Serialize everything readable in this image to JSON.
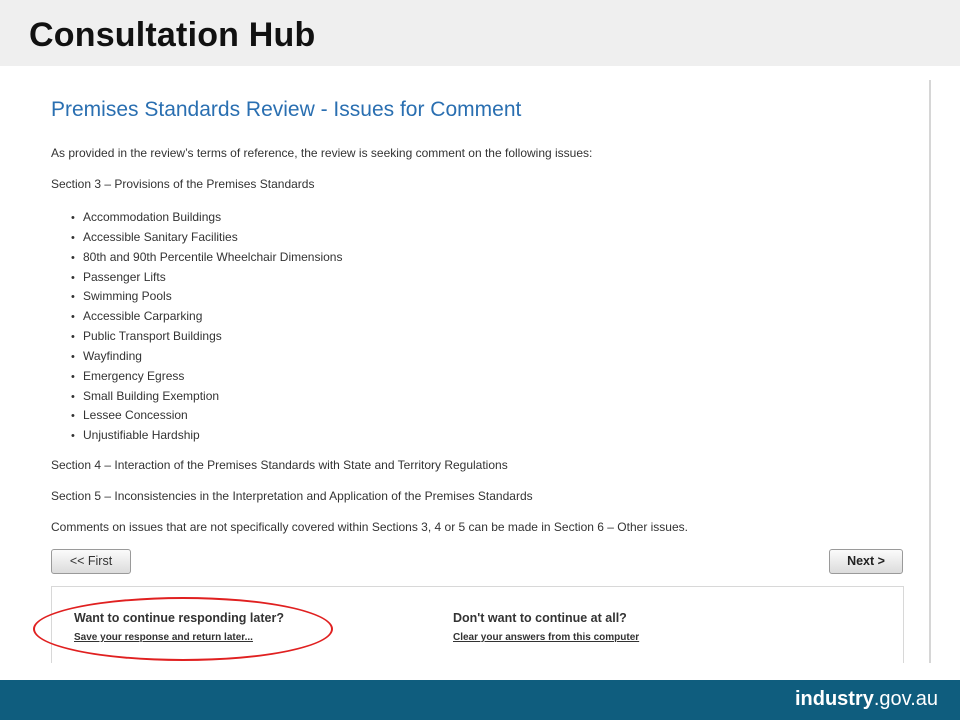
{
  "header": {
    "title": "Consultation Hub"
  },
  "page": {
    "heading": "Premises Standards Review - Issues for Comment",
    "intro": "As provided in the review’s terms of reference, the review is seeking comment on the following issues:",
    "section3": "Section 3 – Provisions of the Premises Standards",
    "issues": [
      "Accommodation Buildings",
      "Accessible Sanitary Facilities",
      "80th and 90th Percentile Wheelchair Dimensions",
      "Passenger Lifts",
      "Swimming Pools",
      "Accessible Carparking",
      "Public Transport Buildings",
      "Wayfinding",
      "Emergency Egress",
      "Small Building Exemption",
      "Lessee Concession",
      "Unjustifiable Hardship"
    ],
    "section4": "Section 4 – Interaction of the Premises Standards with State and Territory Regulations",
    "section5": "Section 5 – Inconsistencies in the Interpretation and Application of the Premises Standards",
    "comments_note": "Comments on issues that are not specifically covered within Sections 3, 4 or 5 can be made in Section 6 – Other issues."
  },
  "nav": {
    "first_label": "<< First",
    "next_label": "Next >"
  },
  "save_panel": {
    "continue_heading": "Want to continue responding later?",
    "continue_link": "Save your response and return later...",
    "stop_heading": "Don't want to continue at all?",
    "stop_link": "Clear your answers from this computer"
  },
  "footer": {
    "brand_bold": "industry",
    "brand_rest": ".gov.au"
  },
  "colors": {
    "heading_blue": "#2a6fb1",
    "footer_teal": "#0f5d7e",
    "annotation_red": "#e02020",
    "header_gray": "#efefef"
  }
}
